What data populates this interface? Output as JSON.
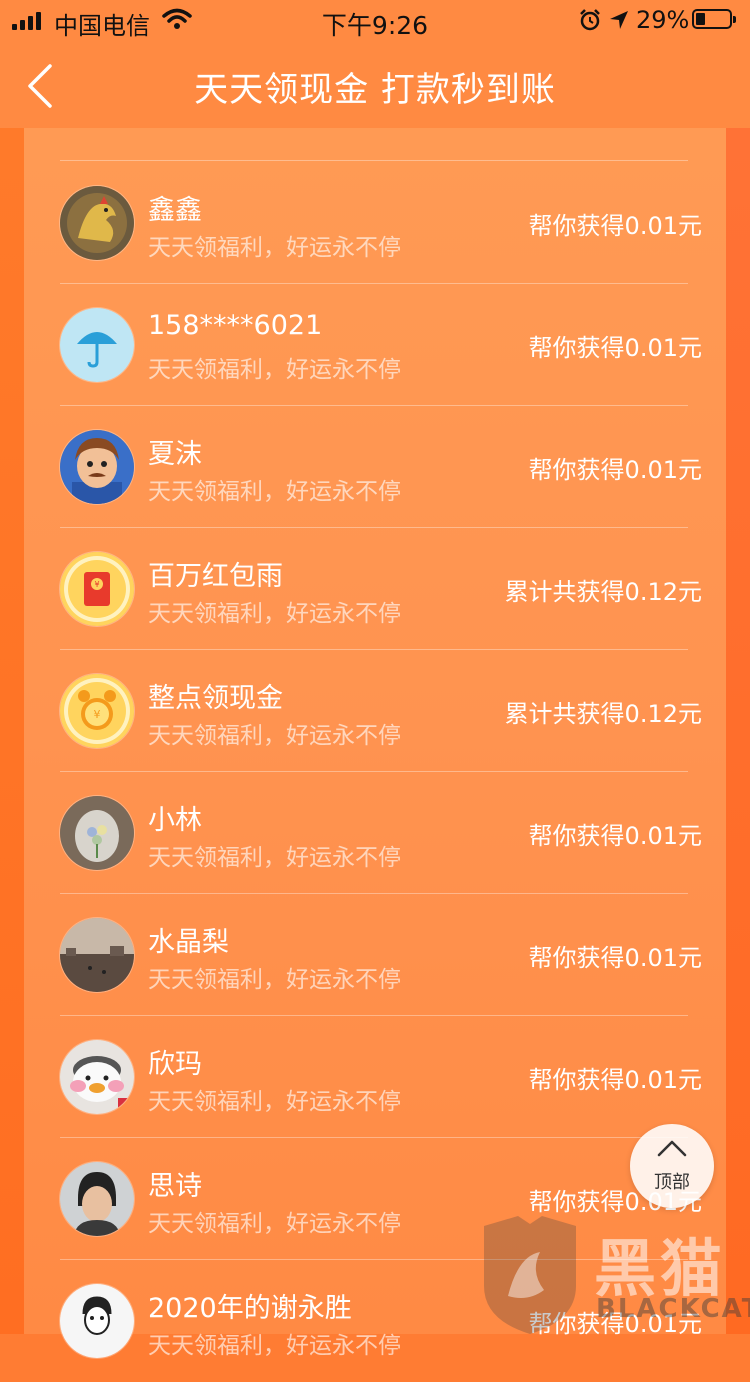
{
  "status_bar": {
    "carrier": "中国电信",
    "time": "下午9:26",
    "battery_percent": "29%",
    "battery_level": 0.29
  },
  "nav": {
    "title": "天天领现金 打款秒到账",
    "back_icon": "chevron-left-icon"
  },
  "list": {
    "items": [
      {
        "name": "鑫鑫",
        "desc": "天天领福利，好运永不停",
        "reward": "帮你获得0.01元",
        "avatar": "rooster-photo"
      },
      {
        "name": "158****6021",
        "desc": "天天领福利，好运永不停",
        "reward": "帮你获得0.01元",
        "avatar": "umbrella-avatar"
      },
      {
        "name": "夏沫",
        "desc": "天天领福利，好运永不停",
        "reward": "帮你获得0.01元",
        "avatar": "cartoon-man"
      },
      {
        "name": "百万红包雨",
        "desc": "天天领福利，好运永不停",
        "reward": "累计共获得0.12元",
        "avatar": "red-envelope-icon"
      },
      {
        "name": "整点领现金",
        "desc": "天天领福利，好运永不停",
        "reward": "累计共获得0.12元",
        "avatar": "alarm-clock-icon"
      },
      {
        "name": "小林",
        "desc": "天天领福利，好运永不停",
        "reward": "帮你获得0.01元",
        "avatar": "flower-photo"
      },
      {
        "name": "水晶梨",
        "desc": "天天领福利，好运永不停",
        "reward": "帮你获得0.01元",
        "avatar": "landscape-photo"
      },
      {
        "name": "欣玛",
        "desc": "天天领福利，好运永不停",
        "reward": "帮你获得0.01元",
        "avatar": "duck-doll-photo"
      },
      {
        "name": "思诗",
        "desc": "天天领福利，好运永不停",
        "reward": "帮你获得0.01元",
        "avatar": "portrait-photo"
      },
      {
        "name": "2020年的谢永胜",
        "desc": "天天领福利，好运永不停",
        "reward": "帮你获得0.01元",
        "avatar": "sketch-avatar"
      }
    ]
  },
  "top_button": {
    "label": "顶部",
    "icon": "chevron-up-icon"
  },
  "watermark": {
    "cn": "黑猫",
    "en": "BLACKCAT"
  },
  "colors": {
    "bg": "#ff8a42",
    "text": "#ffffff",
    "accent": "#ff7a30"
  }
}
